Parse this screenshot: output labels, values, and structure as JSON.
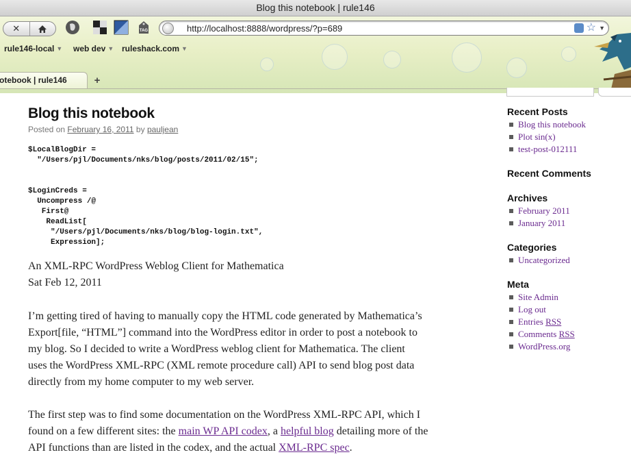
{
  "window": {
    "title": "Blog this notebook | rule146"
  },
  "toolbar": {
    "url": "http://localhost:8888/wordpress/?p=689"
  },
  "bookmarks": [
    {
      "label": "rule146-local"
    },
    {
      "label": "web dev"
    },
    {
      "label": "ruleshack.com"
    }
  ],
  "tabs": {
    "active_label": "otebook | rule146",
    "new_tab_label": "+"
  },
  "post": {
    "title": "Blog this notebook",
    "posted_on": "Posted on",
    "date": "February 16, 2011",
    "by": "by",
    "author": "pauljean",
    "code": "$LocalBlogDir =\n  \"/Users/pjl/Documents/nks/blog/posts/2011/02/15\";\n\n\n$LoginCreds =\n  Uncompress /@\n   First@\n    ReadList[\n     \"/Users/pjl/Documents/nks/blog/blog-login.txt\",\n     Expression];",
    "subtitle_line1": "An XML-RPC WordPress Weblog Client for Mathematica",
    "subtitle_line2": "Sat Feb 12, 2011",
    "para1": [
      "I’m getting tired of having to manually copy the HTML code generated by Mathematica’s",
      "Export[file, “HTML”] command into the WordPress editor in order to post a notebook to",
      "my blog.  So I decided to write a WordPress weblog client for Mathematica.  The client",
      "uses the WordPress XML-RPC (XML remote procedure call) API to send blog post data",
      "directly from my home computer to my web server."
    ],
    "para2": {
      "line1": "The first step was to find some documentation on the WordPress XML-RPC API, which I",
      "line2_a": "found on a few different sites:  the ",
      "link1": "main WP API codex",
      "line2_b": ", a ",
      "link2": "helpful blog",
      "line2_c": " detailing more of the",
      "line3_a": "API functions than are listed in the codex, and the actual ",
      "link3": "XML-RPC spec",
      "line3_b": "."
    }
  },
  "sidebar": {
    "recent_posts": {
      "heading": "Recent Posts",
      "items": [
        "Blog this notebook",
        "Plot sin(x)",
        "test-post-012111"
      ]
    },
    "recent_comments": {
      "heading": "Recent Comments"
    },
    "archives": {
      "heading": "Archives",
      "items": [
        "February 2011",
        "January 2011"
      ]
    },
    "categories": {
      "heading": "Categories",
      "items": [
        "Uncategorized"
      ]
    },
    "meta": {
      "heading": "Meta",
      "site_admin": "Site Admin",
      "log_out": "Log out",
      "entries_a": "Entries ",
      "entries_b": "RSS",
      "comments_a": "Comments ",
      "comments_b": "RSS",
      "wordpress": "WordPress.org"
    }
  }
}
